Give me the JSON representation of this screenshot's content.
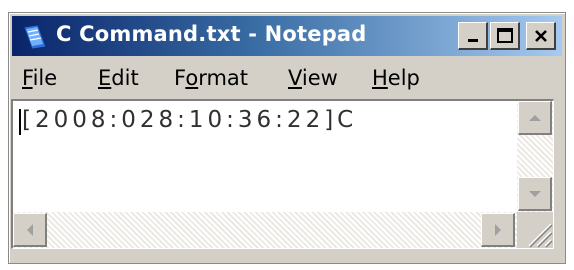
{
  "window": {
    "title": "C Command.txt - Notepad",
    "app_icon": "notepad-icon",
    "controls": {
      "minimize": "minimize-icon",
      "maximize": "maximize-icon",
      "close": "close-icon"
    }
  },
  "menu": {
    "items": [
      {
        "accel": "F",
        "rest": "ile"
      },
      {
        "accel": "E",
        "rest": "dit"
      },
      {
        "pre": "F",
        "accel": "o",
        "rest": "rmat"
      },
      {
        "accel": "V",
        "rest": "iew"
      },
      {
        "accel": "H",
        "rest": "elp"
      }
    ]
  },
  "editor": {
    "content": "[2008:028:10:36:22]C"
  },
  "scrollbars": {
    "up": "arrow-up-icon",
    "down": "arrow-down-icon",
    "left": "arrow-left-icon",
    "right": "arrow-right-icon",
    "grip": "resize-grip-icon"
  },
  "colors": {
    "titlebar_start": "#0a246a",
    "titlebar_end": "#a6caf0",
    "face": "#d4d0c8"
  }
}
